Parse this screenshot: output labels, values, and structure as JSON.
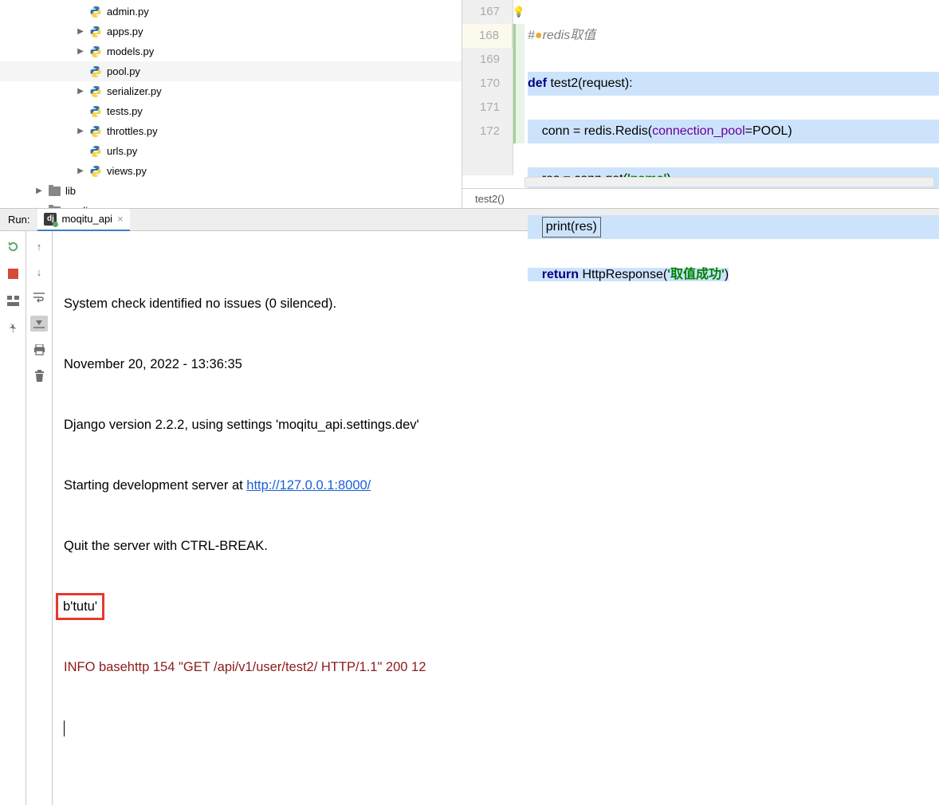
{
  "tree": {
    "files": [
      {
        "indent": 112,
        "name": "admin.py",
        "chev": false
      },
      {
        "indent": 112,
        "name": "apps.py",
        "chev": true
      },
      {
        "indent": 112,
        "name": "models.py",
        "chev": true
      },
      {
        "indent": 112,
        "name": "pool.py",
        "chev": false,
        "sel": true
      },
      {
        "indent": 112,
        "name": "serializer.py",
        "chev": true
      },
      {
        "indent": 112,
        "name": "tests.py",
        "chev": false
      },
      {
        "indent": 112,
        "name": "throttles.py",
        "chev": true
      },
      {
        "indent": 112,
        "name": "urls.py",
        "chev": false
      },
      {
        "indent": 112,
        "name": "views.py",
        "chev": true
      }
    ],
    "folders": [
      {
        "indent": 60,
        "name": "lib"
      },
      {
        "indent": 60,
        "name": "media"
      }
    ]
  },
  "editor": {
    "lines": [
      "167",
      "168",
      "169",
      "170",
      "171",
      "172"
    ],
    "current_line": "168",
    "comment_prefix": "#",
    "comment_text": "redis取值",
    "kw_def": "def",
    "fn_name": "test2",
    "fn_params": "(request):",
    "l3": "    conn = redis.Redis(",
    "l3_arg": "connection_pool",
    "l3_end": "=POOL)",
    "l4a": "    res = conn.get(",
    "l4_str": "'name'",
    "l4b": ")",
    "l5": "print(res)",
    "kw_return": "return",
    "l6a": " HttpResponse(",
    "l6_str": "'取值成功'",
    "l6b": ")",
    "breadcrumb": "test2()"
  },
  "run": {
    "label": "Run:",
    "tab": "moqitu_api",
    "console": {
      "l1": "System check identified no issues (0 silenced).",
      "l2": "November 20, 2022 - 13:36:35",
      "l3": "Django version 2.2.2, using settings 'moqitu_api.settings.dev'",
      "l4a": "Starting development server at ",
      "l4_link": "http://127.0.0.1:8000/",
      "l5": "Quit the server with CTRL-BREAK.",
      "l6": "b'tutu'",
      "l7": "INFO basehttp 154 \"GET /api/v1/user/test2/ HTTP/1.1\" 200 12"
    }
  }
}
